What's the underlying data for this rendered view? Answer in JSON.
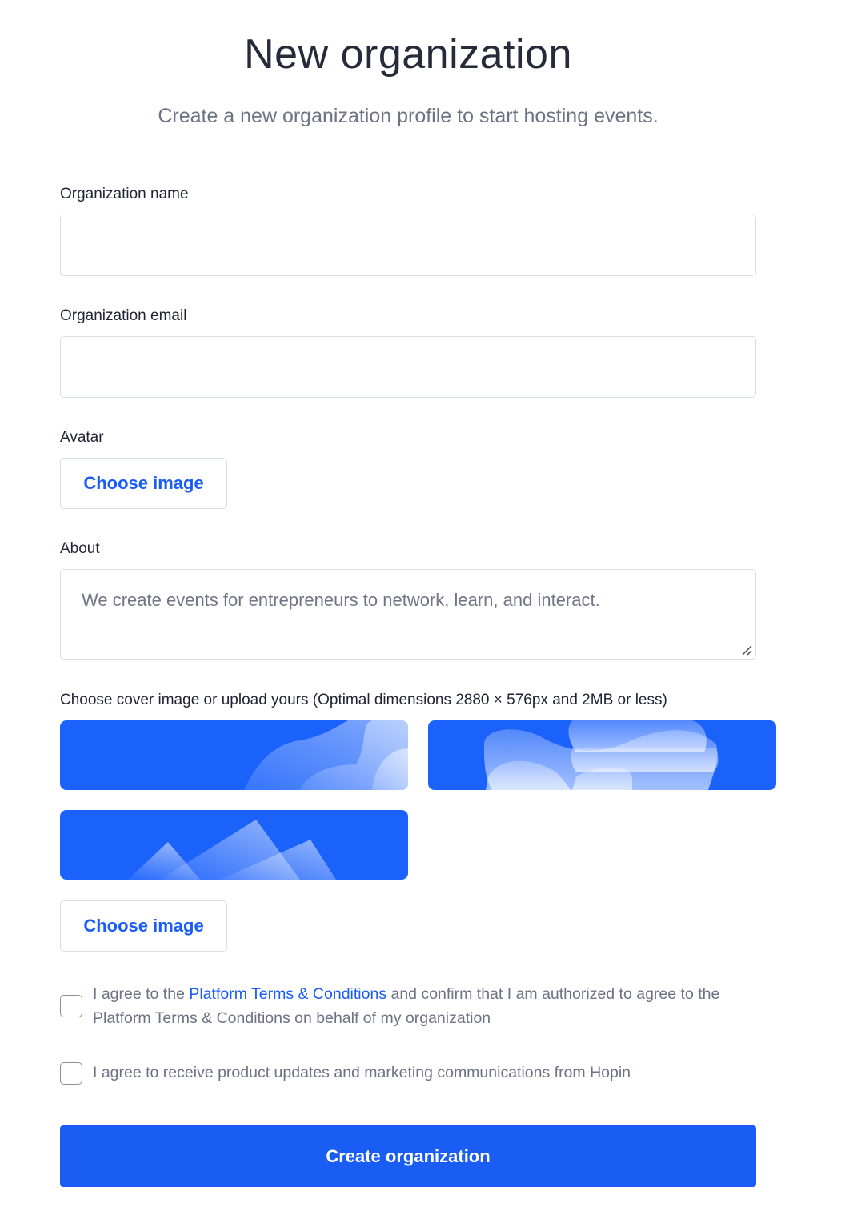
{
  "header": {
    "title": "New organization",
    "subtitle": "Create a new organization profile to start hosting events."
  },
  "form": {
    "name_label": "Organization name",
    "name_value": "",
    "email_label": "Organization email",
    "email_value": "",
    "avatar_label": "Avatar",
    "avatar_button": "Choose image",
    "about_label": "About",
    "about_placeholder": "We create events for entrepreneurs to network, learn, and interact.",
    "cover_label": "Choose cover image or upload yours (Optimal dimensions 2880 × 576px and 2MB or less)",
    "cover_options": [
      "cover-waves",
      "cover-blobs",
      "cover-mountains"
    ],
    "cover_button": "Choose image",
    "terms": {
      "prefix": "I agree to the ",
      "link": "Platform Terms & Conditions",
      "suffix": " and confirm that I am authorized to agree to the Platform Terms & Conditions on behalf of my organization",
      "checked": false
    },
    "marketing": {
      "text": "I agree to receive product updates and marketing communications from Hopin",
      "checked": false
    },
    "submit_label": "Create organization"
  },
  "colors": {
    "accent": "#1a5df5",
    "cover_bg": "#1b62fb",
    "title": "#252b3a",
    "muted": "#6b7384",
    "border": "#d9dde4"
  }
}
